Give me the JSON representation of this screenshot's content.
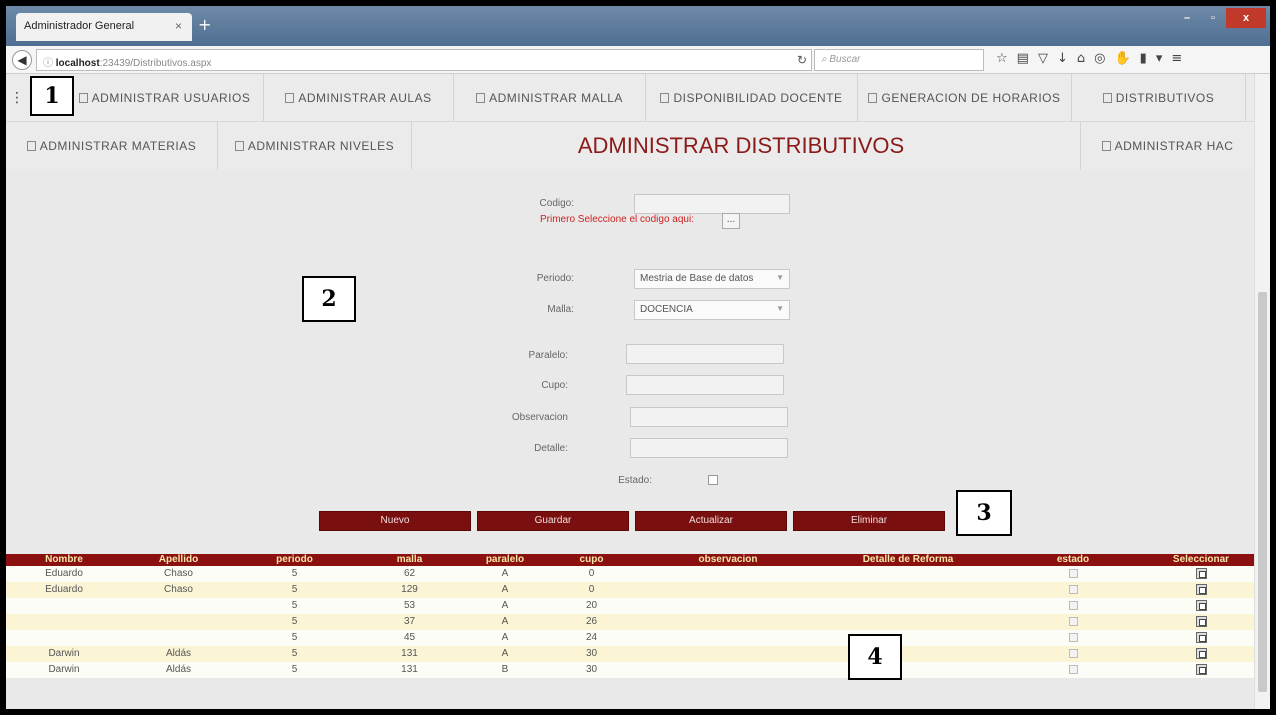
{
  "browser": {
    "tab_title": "Administrador General",
    "tab_close": "×",
    "new_tab": "+",
    "url_host": "localhost",
    "url_rest": ":23439/Distributivos.aspx",
    "search_placeholder": "Buscar",
    "win_min": "–",
    "win_max": "▫",
    "win_close": "x"
  },
  "menu": {
    "row1": [
      "ADMINISTRAR USUARIOS",
      "ADMINISTRAR AULAS",
      "ADMINISTRAR MALLA",
      "DISPONIBILIDAD DOCENTE",
      "GENERACION DE HORARIOS",
      "DISTRIBUTIVOS"
    ],
    "row2_left": [
      "ADMINISTRAR MATERIAS",
      "ADMINISTRAR NIVELES"
    ],
    "row2_right": "ADMINISTRAR HAC"
  },
  "page_title": "ADMINISTRAR DISTRIBUTIVOS",
  "form": {
    "codigo_label": "Codigo:",
    "codigo_hint": "Primero Seleccione el codigo aqui:",
    "codigo_btn": "...",
    "periodo_label": "Periodo:",
    "periodo_value": "Mestria de Base de datos",
    "malla_label": "Malla:",
    "malla_value": "DOCENCIA",
    "paralelo_label": "Paralelo:",
    "cupo_label": "Cupo:",
    "observacion_label": "Observacion",
    "detalle_label": "Detalle:",
    "estado_label": "Estado:"
  },
  "buttons": {
    "nuevo": "Nuevo",
    "guardar": "Guardar",
    "actualizar": "Actualizar",
    "eliminar": "Eliminar"
  },
  "table": {
    "headers": [
      "Nombre",
      "Apellido",
      "periodo",
      "malla",
      "paralelo",
      "cupo",
      "observacion",
      "Detalle de Reforma",
      "estado",
      "Seleccionar"
    ],
    "rows": [
      [
        "Eduardo",
        "Chaso",
        "5",
        "62",
        "A",
        "0",
        "",
        ""
      ],
      [
        "Eduardo",
        "Chaso",
        "5",
        "129",
        "A",
        "0",
        "",
        ""
      ],
      [
        "",
        "",
        "5",
        "53",
        "A",
        "20",
        "",
        ""
      ],
      [
        "",
        "",
        "5",
        "37",
        "A",
        "26",
        "",
        ""
      ],
      [
        "",
        "",
        "5",
        "45",
        "A",
        "24",
        "",
        ""
      ],
      [
        "Darwin",
        "Aldás",
        "5",
        "131",
        "A",
        "30",
        "",
        ""
      ],
      [
        "Darwin",
        "Aldás",
        "5",
        "131",
        "B",
        "30",
        "",
        ""
      ]
    ]
  },
  "callouts": [
    "1",
    "2",
    "3",
    "4"
  ]
}
